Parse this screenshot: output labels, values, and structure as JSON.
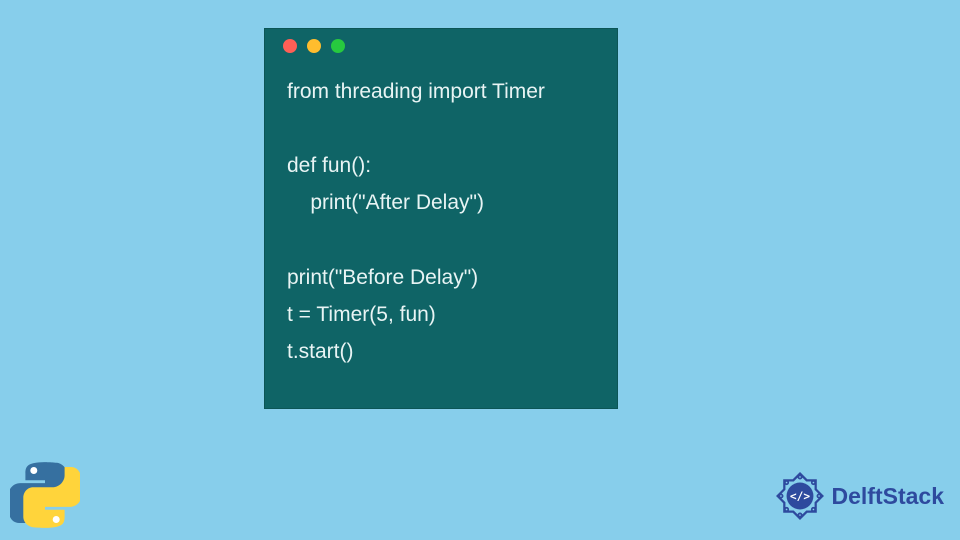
{
  "code": {
    "lines": [
      "from threading import Timer",
      "",
      "def fun():",
      "    print(\"After Delay\")",
      "",
      "print(\"Before Delay\")",
      "t = Timer(5, fun)",
      "t.start()"
    ]
  },
  "footer": {
    "brand": "DelftStack"
  },
  "colors": {
    "background": "#87ceeb",
    "window": "#0f6466",
    "codeText": "#e8f4f4",
    "pythonBlue": "#3670a0",
    "pythonYellow": "#ffd43b",
    "brandBlue": "#2e4a9e"
  }
}
